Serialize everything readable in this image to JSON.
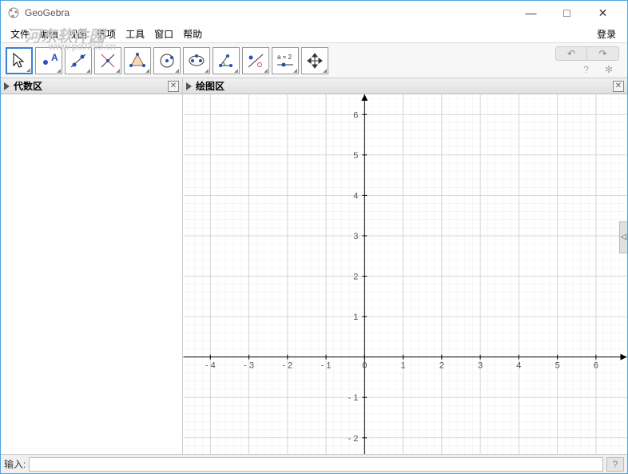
{
  "window": {
    "title": "GeoGebra",
    "min": "—",
    "max": "□",
    "close": "✕"
  },
  "watermark": {
    "line1": "河东软件园",
    "line2": "www.pc0359.cn"
  },
  "menu": {
    "file": "文件",
    "edit": "编辑",
    "view": "视图",
    "options": "选项",
    "tools": "工具",
    "window": "窗口",
    "help": "帮助",
    "login": "登录"
  },
  "toolbar": {
    "undo": "↶",
    "redo": "↷",
    "help_icon": "?",
    "settings_icon": "✻",
    "slider_label": "a = 2"
  },
  "panels": {
    "algebra": {
      "title": "代数区",
      "close": "✕"
    },
    "graphics": {
      "title": "绘图区",
      "close": "✕"
    }
  },
  "inputbar": {
    "label": "输入:",
    "value": "",
    "help": "?"
  },
  "expand_handle": "◁",
  "chart_data": {
    "type": "coordinate-plane",
    "x_ticks": [
      -4,
      -3,
      -2,
      -1,
      0,
      1,
      2,
      3,
      4,
      5,
      6
    ],
    "y_ticks": [
      -2,
      -1,
      1,
      2,
      3,
      4,
      5,
      6
    ],
    "xlim": [
      -4.7,
      6.8
    ],
    "ylim": [
      -2.4,
      6.5
    ],
    "origin_label": "0",
    "grid_major": 1,
    "grid_minor": 0.2,
    "series": []
  }
}
